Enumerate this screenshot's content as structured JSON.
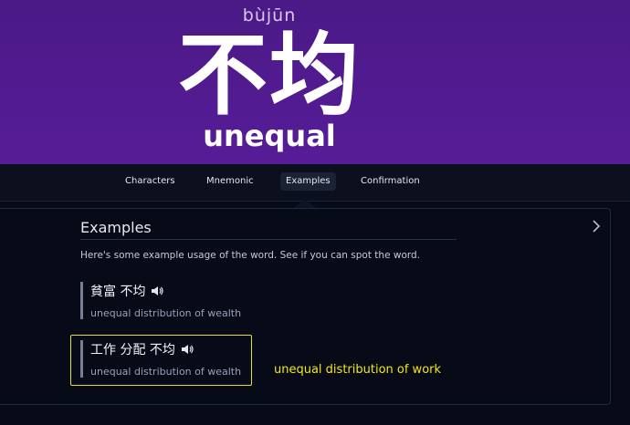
{
  "word": {
    "pinyin": "bùjūn",
    "hanzi": "不均",
    "meaning": "unequal"
  },
  "tabs": [
    {
      "label": "Characters",
      "active": false
    },
    {
      "label": "Mnemonic",
      "active": false
    },
    {
      "label": "Examples",
      "active": true
    },
    {
      "label": "Confirmation",
      "active": false
    }
  ],
  "examples_section": {
    "title": "Examples",
    "intro": "Here's some example usage of the word. See if you can spot the word.",
    "items": [
      {
        "chinese": "貧富 不均",
        "english": "unequal distribution of wealth"
      },
      {
        "chinese": "工作 分配 不均",
        "english": "unequal distribution of wealth"
      }
    ]
  },
  "annotation": {
    "text": "unequal distribution of work",
    "color": "#f3e719"
  },
  "colors": {
    "header_bg": "#571c98",
    "page_bg": "#070a17",
    "highlight": "#e7df2a"
  },
  "icons": {
    "speaker": "speaker-icon",
    "next": "chevron-right-icon"
  }
}
